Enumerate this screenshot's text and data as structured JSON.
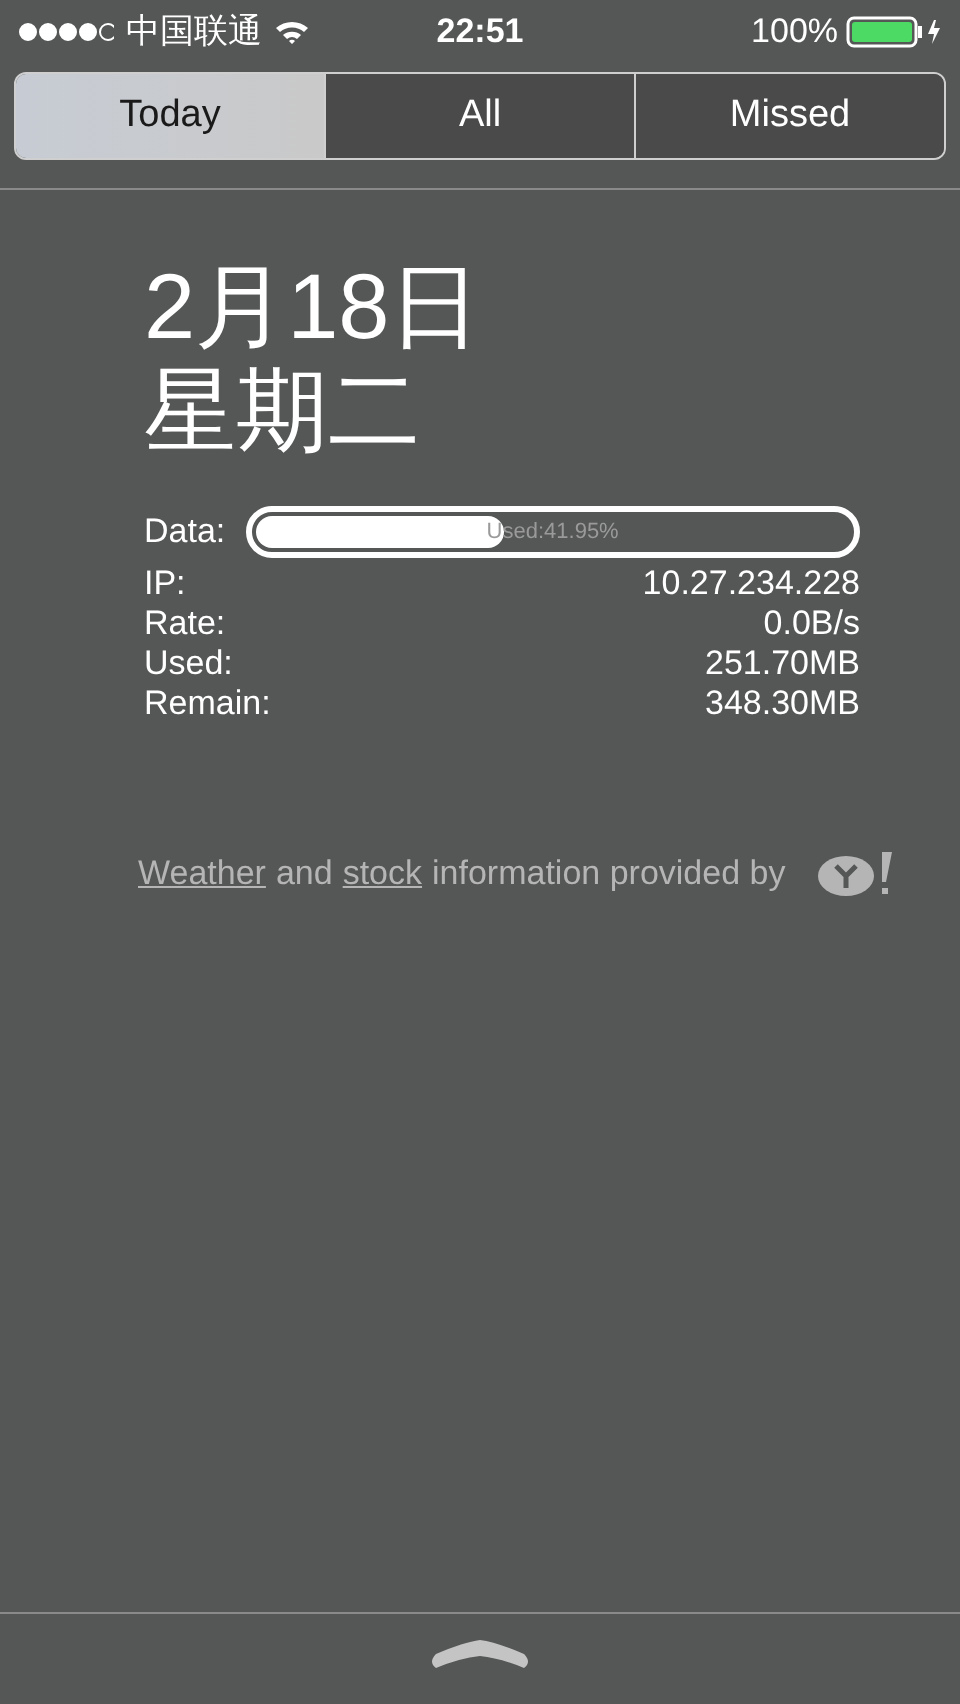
{
  "status_bar": {
    "carrier": "中国联通",
    "time": "22:51",
    "battery": "100%"
  },
  "tabs": [
    {
      "label": "Today",
      "selected": true
    },
    {
      "label": "All",
      "selected": false
    },
    {
      "label": "Missed",
      "selected": false
    }
  ],
  "date": {
    "day": "2月18日",
    "weekday": "星期二"
  },
  "stats": {
    "data_label": "Data:",
    "usage": {
      "level": 0.4195,
      "reading": "Used:41.95%"
    },
    "rows": [
      {
        "label": "IP:",
        "value": "10.27.234.228"
      },
      {
        "label": "Rate:",
        "value": "0.0B/s"
      },
      {
        "label": "Used:",
        "value": "251.70MB"
      },
      {
        "label": "Remain:",
        "value": "348.30MB"
      }
    ]
  },
  "attribution": {
    "link_1": "Weather",
    "text_1": "and",
    "link_2": "stock",
    "text_2": "information provided by"
  }
}
